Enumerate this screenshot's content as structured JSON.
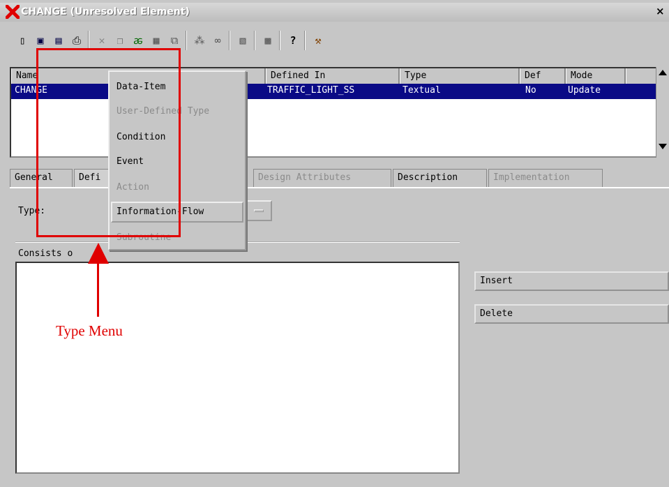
{
  "window": {
    "title": "CHANGE (Unresolved Element)",
    "close": "×"
  },
  "toolbar": {
    "icons": [
      "new-icon",
      "save-icon",
      "save-down-icon",
      "print-icon",
      "delete-icon",
      "copy-icon",
      "check-icon",
      "diagram-icon",
      "link-icon",
      "tree-icon",
      "binoculars-icon",
      "graph-icon",
      "compare-icon",
      "help-icon",
      "tool-icon"
    ]
  },
  "table": {
    "headers": [
      "Name",
      "Defined In",
      "Type",
      "Def",
      "Mode"
    ],
    "row": {
      "name": "CHANGE",
      "defined_in": "TRAFFIC_LIGHT_SS",
      "type": "Textual",
      "def": "No",
      "mode": "Update"
    }
  },
  "tabs": [
    "General",
    "Defi",
    "Design Attributes",
    "Description",
    "Implementation"
  ],
  "type_label": "Type:",
  "consists_label": "Consists o",
  "buttons": {
    "insert": "Insert",
    "delete": "Delete"
  },
  "type_menu": {
    "items": [
      {
        "label": "Data-Item",
        "enabled": true
      },
      {
        "label": "User-Defined Type",
        "enabled": false
      },
      {
        "label": "Condition",
        "enabled": true
      },
      {
        "label": "Event",
        "enabled": true
      },
      {
        "label": "Action",
        "enabled": false
      },
      {
        "label": "Information-Flow",
        "enabled": true
      },
      {
        "label": "Subroutine",
        "enabled": false
      }
    ]
  },
  "annotation": {
    "label": "Type Menu",
    "color": "#e00000"
  },
  "colors": {
    "selection": "#0a0a86",
    "window_bg": "#c6c6c6"
  }
}
